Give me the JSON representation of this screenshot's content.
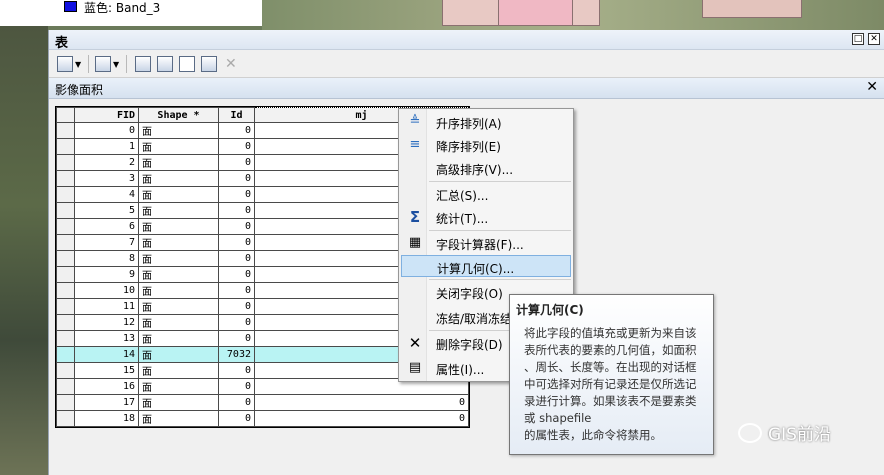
{
  "toc": {
    "band_label": "蓝色:   Band_3",
    "band_color": "#1010e0"
  },
  "window": {
    "title": "表"
  },
  "toolbar": {
    "icons": [
      "table-options-icon",
      "related-tables-icon",
      "select-by-attributes-icon",
      "switch-selection-icon",
      "clear-selection-icon",
      "zoom-to-selected-icon",
      "delete-selected-icon"
    ]
  },
  "subtab": {
    "title": "影像面积"
  },
  "grid": {
    "columns": [
      "FID",
      "Shape *",
      "Id",
      "mj"
    ],
    "rows": [
      {
        "fid": "0",
        "shape": "面",
        "id": "0",
        "mj": ""
      },
      {
        "fid": "1",
        "shape": "面",
        "id": "0",
        "mj": ""
      },
      {
        "fid": "2",
        "shape": "面",
        "id": "0",
        "mj": ""
      },
      {
        "fid": "3",
        "shape": "面",
        "id": "0",
        "mj": ""
      },
      {
        "fid": "4",
        "shape": "面",
        "id": "0",
        "mj": ""
      },
      {
        "fid": "5",
        "shape": "面",
        "id": "0",
        "mj": ""
      },
      {
        "fid": "6",
        "shape": "面",
        "id": "0",
        "mj": ""
      },
      {
        "fid": "7",
        "shape": "面",
        "id": "0",
        "mj": ""
      },
      {
        "fid": "8",
        "shape": "面",
        "id": "0",
        "mj": ""
      },
      {
        "fid": "9",
        "shape": "面",
        "id": "0",
        "mj": ""
      },
      {
        "fid": "10",
        "shape": "面",
        "id": "0",
        "mj": ""
      },
      {
        "fid": "11",
        "shape": "面",
        "id": "0",
        "mj": ""
      },
      {
        "fid": "12",
        "shape": "面",
        "id": "0",
        "mj": ""
      },
      {
        "fid": "13",
        "shape": "面",
        "id": "0",
        "mj": ""
      },
      {
        "fid": "14",
        "shape": "面",
        "id": "7032",
        "mj": "",
        "highlighted": true
      },
      {
        "fid": "15",
        "shape": "面",
        "id": "0",
        "mj": ""
      },
      {
        "fid": "16",
        "shape": "面",
        "id": "0",
        "mj": ""
      },
      {
        "fid": "17",
        "shape": "面",
        "id": "0",
        "mj": "0"
      },
      {
        "fid": "18",
        "shape": "面",
        "id": "0",
        "mj": "0"
      }
    ],
    "highlight_color": "#b9f3f3"
  },
  "context_menu": {
    "items": [
      {
        "label": "升序排列(A)",
        "icon": "sort-ascending-icon"
      },
      {
        "label": "降序排列(E)",
        "icon": "sort-descending-icon"
      },
      {
        "label": "高级排序(V)...",
        "icon": ""
      },
      {
        "label": "汇总(S)...",
        "icon": ""
      },
      {
        "label": "统计(T)...",
        "icon": "sigma-icon"
      },
      {
        "label": "字段计算器(F)...",
        "icon": "calculator-icon"
      },
      {
        "label": "计算几何(C)...",
        "icon": "",
        "hot": true
      },
      {
        "label": "关闭字段(O)",
        "icon": ""
      },
      {
        "label": "冻结/取消冻结",
        "icon": ""
      },
      {
        "label": "删除字段(D)",
        "icon": "delete-x-icon"
      },
      {
        "label": "属性(I)...",
        "icon": "properties-icon"
      }
    ]
  },
  "tooltip": {
    "title": "计算几何(C)",
    "body": "将此字段的值填充或更新为来自该\n表所代表的要素的几何值，如面积\n、周长、长度等。在出现的对话框\n中可选择对所有记录还是仅所选记\n录进行计算。如果该表不是要素类\n或 shapefile\n的属性表，此命令将禁用。"
  },
  "watermark": {
    "text": "GIS前沿"
  }
}
